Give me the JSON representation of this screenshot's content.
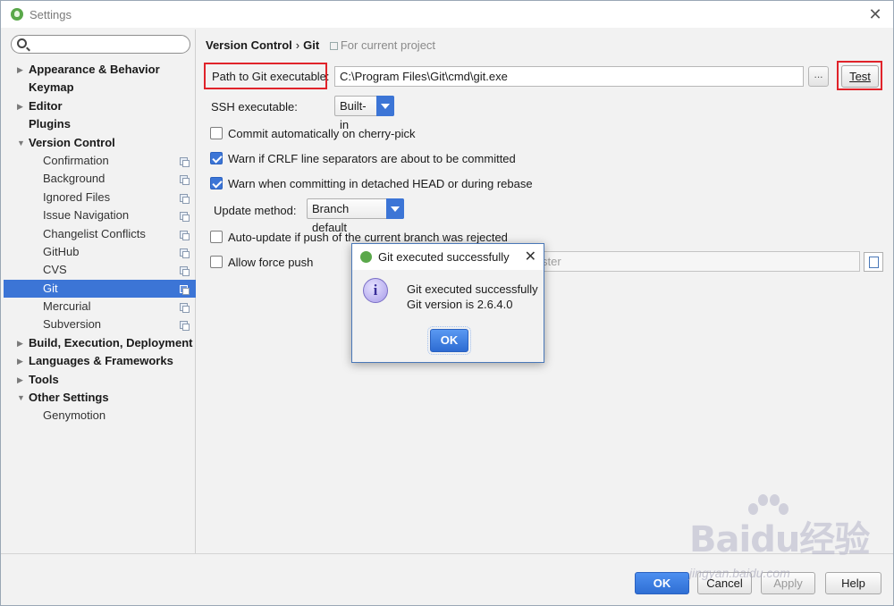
{
  "window": {
    "title": "Settings"
  },
  "search": {
    "placeholder": ""
  },
  "sidebar": {
    "items": [
      {
        "label": "Appearance & Behavior"
      },
      {
        "label": "Keymap"
      },
      {
        "label": "Editor"
      },
      {
        "label": "Plugins"
      },
      {
        "label": "Version Control"
      },
      {
        "label": "Confirmation"
      },
      {
        "label": "Background"
      },
      {
        "label": "Ignored Files"
      },
      {
        "label": "Issue Navigation"
      },
      {
        "label": "Changelist Conflicts"
      },
      {
        "label": "GitHub"
      },
      {
        "label": "CVS"
      },
      {
        "label": "Git"
      },
      {
        "label": "Mercurial"
      },
      {
        "label": "Subversion"
      },
      {
        "label": "Build, Execution, Deployment"
      },
      {
        "label": "Languages & Frameworks"
      },
      {
        "label": "Tools"
      },
      {
        "label": "Other Settings"
      },
      {
        "label": "Genymotion"
      }
    ]
  },
  "breadcrumb": {
    "parent": "Version Control",
    "sep": "›",
    "current": "Git",
    "scope": "For current project"
  },
  "git": {
    "path_label": "Path to Git executable:",
    "path_value": "C:\\Program Files\\Git\\cmd\\git.exe",
    "browse_label": "...",
    "test_label": "Test",
    "ssh_label": "SSH executable:",
    "ssh_value": "Built-in",
    "cherry_pick_label": "Commit automatically on cherry-pick",
    "crlf_label": "Warn if CRLF line separators are about to be committed",
    "detached_label": "Warn when committing in detached HEAD or during rebase",
    "update_method_label": "Update method:",
    "update_method_value": "Branch default",
    "auto_update_label": "Auto-update if push of the current branch was rejected",
    "force_push_label": "Allow force push",
    "protected_branches_value": "ster"
  },
  "footer": {
    "ok": "OK",
    "cancel": "Cancel",
    "apply": "Apply",
    "help": "Help"
  },
  "dialog": {
    "title": "Git executed successfully",
    "line1": "Git executed successfully",
    "line2": "Git version is 2.6.4.0",
    "ok": "OK"
  },
  "watermark": {
    "brand": "Baidu经验",
    "url": "jingyan.baidu.com"
  },
  "colors": {
    "accent": "#3c75d6",
    "highlight": "#e0232a"
  }
}
